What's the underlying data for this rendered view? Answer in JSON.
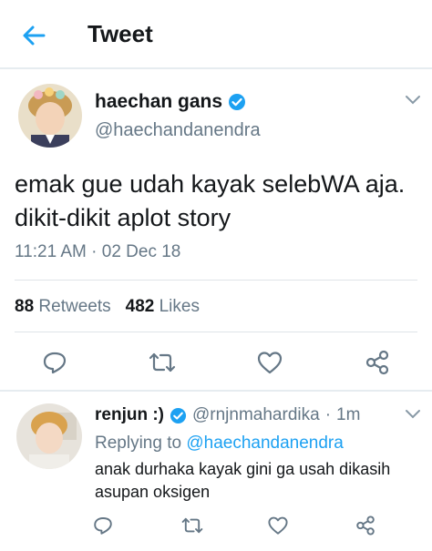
{
  "header": {
    "title": "Tweet",
    "back_icon": "back-arrow-icon"
  },
  "tweet": {
    "display_name": "haechan gans",
    "handle": "@haechandanendra",
    "verified": true,
    "text": "emak gue udah kayak selebWA aja. dikit-dikit aplot story",
    "timestamp": "11:21 AM · 02 Dec 18",
    "retweets_count": "88",
    "retweets_label": "Retweets",
    "likes_count": "482",
    "likes_label": "Likes"
  },
  "reply": {
    "display_name": "renjun :)",
    "handle": "@rnjnmahardika",
    "separator": "·",
    "time_ago": "1m",
    "verified": true,
    "replying_prefix": "Replying to",
    "replying_to": "@haechandanendra",
    "text": "anak durhaka kayak gini ga usah dikasih asupan oksigen"
  },
  "actions": [
    "reply-icon",
    "retweet-icon",
    "like-icon",
    "share-icon"
  ],
  "colors": {
    "accent": "#1da1f2",
    "muted": "#657786",
    "text": "#14171a",
    "divider": "#e6ecf0"
  }
}
